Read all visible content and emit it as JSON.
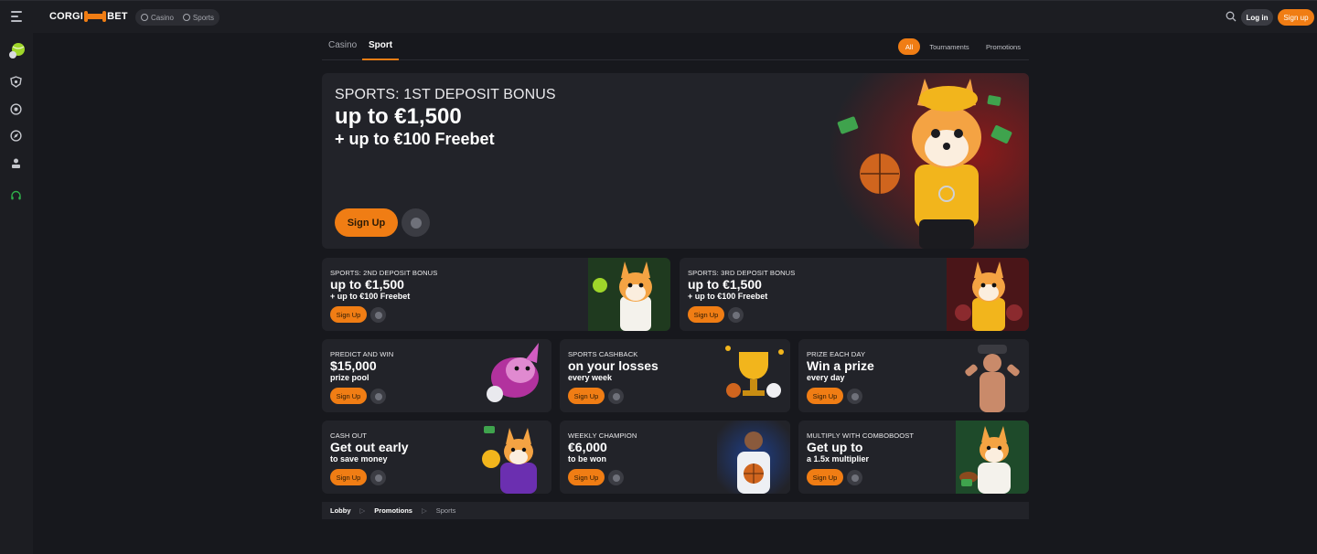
{
  "header": {
    "logo_left": "CORGI",
    "logo_right": "BET",
    "modes": [
      "Casino",
      "Sports"
    ],
    "login_label": "Log in",
    "signup_label": "Sign up"
  },
  "tabs": {
    "items": [
      "Casino",
      "Sport"
    ],
    "active": "Sport",
    "filters": [
      "All",
      "Tournaments",
      "Promotions"
    ],
    "active_filter": "All"
  },
  "hero": {
    "subtitle": "SPORTS: 1ST DEPOSIT BONUS",
    "title": "up to €1,500",
    "line2": "+ up to €100 Freebet",
    "button": "Sign Up"
  },
  "promos": [
    {
      "subtitle": "SPORTS: 2ND DEPOSIT BONUS",
      "title": "up to €1,500",
      "line2": "+ up to €100 Freebet",
      "button": "Sign Up"
    },
    {
      "subtitle": "SPORTS: 3RD DEPOSIT BONUS",
      "title": "up to €1,500",
      "line2": "+ up to €100 Freebet",
      "button": "Sign Up"
    },
    {
      "subtitle": "PREDICT AND WIN",
      "title": "$15,000",
      "line2": "prize pool",
      "button": "Sign Up"
    },
    {
      "subtitle": "SPORTS CASHBACK",
      "title": "on your losses",
      "line2": "every week",
      "button": "Sign Up"
    },
    {
      "subtitle": "PRIZE EACH DAY",
      "title": "Win a prize",
      "line2": "every day",
      "button": "Sign Up"
    },
    {
      "subtitle": "CASH OUT",
      "title": "Get out early",
      "line2": "to save money",
      "button": "Sign Up"
    },
    {
      "subtitle": "WEEKLY CHAMPION",
      "title": "€6,000",
      "line2": "to be won",
      "button": "Sign Up"
    },
    {
      "subtitle": "MULTIPLY WITH COMBOBOOST",
      "title": "Get up to",
      "line2": "a 1.5x multiplier",
      "button": "Sign Up"
    }
  ],
  "breadcrumb": [
    "Lobby",
    "Promotions",
    "Sports"
  ],
  "colors": {
    "accent": "#f07d14",
    "background": "#17181d",
    "card": "#222329"
  },
  "icons": [
    "menu-icon",
    "search-icon",
    "tennis-ball-icon",
    "shield-icon",
    "target-icon",
    "compass-icon",
    "user-icon",
    "headset-icon",
    "info-icon"
  ]
}
